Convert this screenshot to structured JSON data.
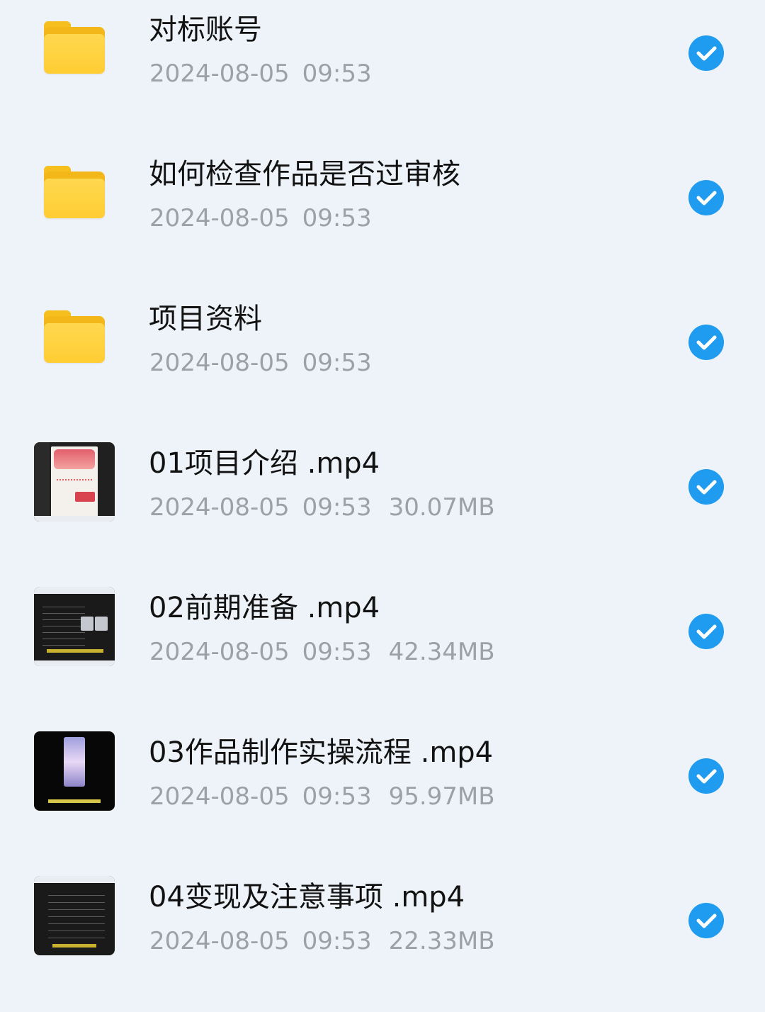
{
  "files": [
    {
      "type": "folder",
      "icon": "folder-icon",
      "name": "对标账号",
      "date": "2024-08-05",
      "time": "09:53",
      "size": "",
      "selected": true
    },
    {
      "type": "folder",
      "icon": "folder-icon",
      "name": "如何检查作品是否过审核",
      "date": "2024-08-05",
      "time": "09:53",
      "size": "",
      "selected": true
    },
    {
      "type": "folder",
      "icon": "folder-icon",
      "name": "项目资料",
      "date": "2024-08-05",
      "time": "09:53",
      "size": "",
      "selected": true
    },
    {
      "type": "video",
      "icon": "video-thumbnail",
      "name": "01项目介绍 .mp4",
      "date": "2024-08-05",
      "time": "09:53",
      "size": "30.07MB",
      "selected": true
    },
    {
      "type": "video",
      "icon": "video-thumbnail",
      "name": "02前期准备 .mp4",
      "date": "2024-08-05",
      "time": "09:53",
      "size": "42.34MB",
      "selected": true
    },
    {
      "type": "video",
      "icon": "video-thumbnail",
      "name": "03作品制作实操流程 .mp4",
      "date": "2024-08-05",
      "time": "09:53",
      "size": "95.97MB",
      "selected": true
    },
    {
      "type": "video",
      "icon": "video-thumbnail",
      "name": "04变现及注意事项 .mp4",
      "date": "2024-08-05",
      "time": "09:53",
      "size": "22.33MB",
      "selected": true
    }
  ],
  "colors": {
    "background": "#eef3f9",
    "check": "#1f9bf0",
    "folder": "#ffcd33",
    "meta_text": "#9aa1a8",
    "name_text": "#121212"
  }
}
